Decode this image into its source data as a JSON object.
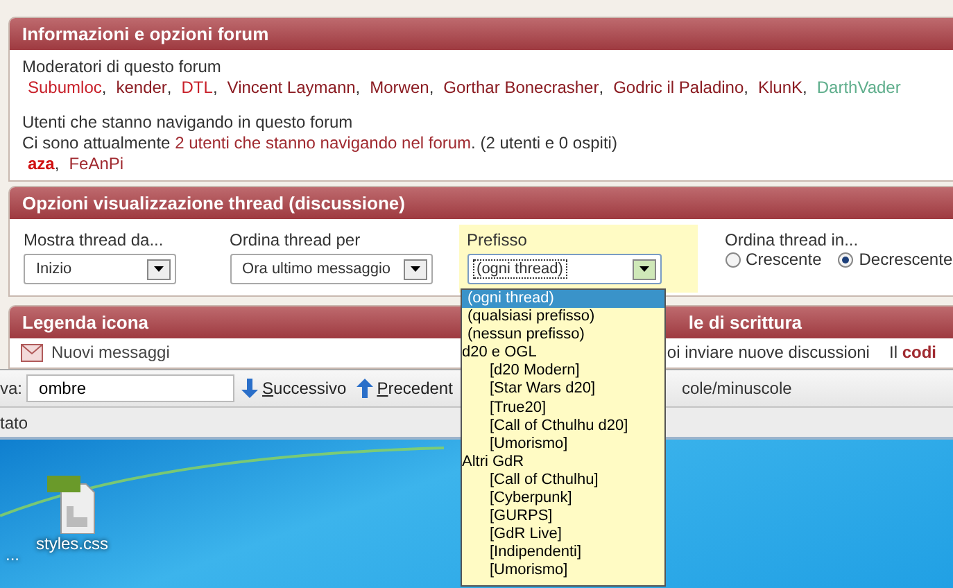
{
  "forum_info": {
    "title": "Informazioni e opzioni forum",
    "moderators_label": "Moderatori di questo forum",
    "separator": ",",
    "moderators": [
      {
        "name": "Subumloc",
        "color": "#c8202a"
      },
      {
        "name": "kender",
        "color": "#8b1c22"
      },
      {
        "name": "DTL",
        "color": "#c8202a"
      },
      {
        "name": "Vincent Laymann",
        "color": "#8b1c22"
      },
      {
        "name": "Morwen",
        "color": "#8b1c22"
      },
      {
        "name": "Gorthar Bonecrasher",
        "color": "#8b1c22"
      },
      {
        "name": "Godric il Paladino",
        "color": "#8b1c22"
      },
      {
        "name": "KlunK",
        "color": "#8b1c22"
      },
      {
        "name": "DarthVader",
        "color": "#5fae8c"
      }
    ],
    "browsing_label": "Utenti che stanno navigando in questo forum",
    "browsing_prefix": "Ci sono attualmente ",
    "browsing_link": "2 utenti che stanno navigando nel forum",
    "browsing_suffix": ". (2 utenti e 0 ospiti)",
    "users": [
      {
        "name": "aza",
        "bold": true,
        "color": "#d01010"
      },
      {
        "name": "FeAnPi",
        "bold": false,
        "color": "#a02a30"
      }
    ]
  },
  "display_options": {
    "title": "Opzioni visualizzazione thread (discussione)",
    "selects": [
      {
        "label": "Mostra thread da...",
        "value": "Inizio",
        "focused": false
      },
      {
        "label": "Ordina thread per",
        "value": "Ora ultimo messaggio",
        "focused": false
      },
      {
        "label": "Prefisso",
        "value": "(ogni thread)",
        "focused": true,
        "options": [
          {
            "kind": "option",
            "label": "(ogni thread)",
            "selected": true
          },
          {
            "kind": "option",
            "label": "(qualsiasi prefisso)",
            "selected": false
          },
          {
            "kind": "option",
            "label": "(nessun prefisso)",
            "selected": false
          },
          {
            "kind": "group",
            "label": "d20 e OGL",
            "children": [
              {
                "kind": "option",
                "label": "[d20 Modern]",
                "selected": false
              },
              {
                "kind": "option",
                "label": "[Star Wars d20]",
                "selected": false
              },
              {
                "kind": "option",
                "label": "[True20]",
                "selected": false
              },
              {
                "kind": "option",
                "label": "[Call of Cthulhu d20]",
                "selected": false
              },
              {
                "kind": "option",
                "label": "[Umorismo]",
                "selected": false
              }
            ]
          },
          {
            "kind": "group",
            "label": "Altri GdR",
            "children": [
              {
                "kind": "option",
                "label": "[Call of Cthulhu]",
                "selected": false
              },
              {
                "kind": "option",
                "label": "[Cyberpunk]",
                "selected": false
              },
              {
                "kind": "option",
                "label": "[GURPS]",
                "selected": false
              },
              {
                "kind": "option",
                "label": "[GdR Live]",
                "selected": false
              },
              {
                "kind": "option",
                "label": "[Indipendenti]",
                "selected": false
              },
              {
                "kind": "option",
                "label": "[Umorismo]",
                "selected": false
              }
            ]
          }
        ]
      }
    ],
    "order_label": "Ordina thread in...",
    "order": [
      {
        "label": "Crescente",
        "selected": false
      },
      {
        "label": "Decrescente",
        "selected": true
      }
    ]
  },
  "legend": {
    "title": "Legenda icona",
    "right_title": "le di scrittura",
    "item": "Nuovi messaggi",
    "right_text": "oi inviare nuove discussioni",
    "right_code": "Il **codi**"
  },
  "find_bar": {
    "label": "va:",
    "value": "ombre",
    "buttons": [
      "Successivo",
      "Precedent"
    ],
    "text": "cole/minuscole"
  },
  "status_bar": {
    "text": "tato"
  },
  "desktop": {
    "icons": [
      {
        "label": "...",
        "kind": "cut"
      },
      {
        "label": "styles.css",
        "kind": "css"
      }
    ]
  }
}
